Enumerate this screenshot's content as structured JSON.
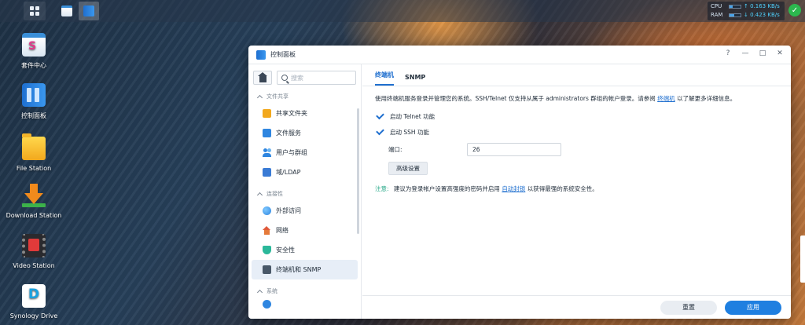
{
  "taskbar": {
    "resource_monitor": {
      "cpu_label": "CPU",
      "cpu_value": "↑ 0.163 KB/s",
      "ram_label": "RAM",
      "ram_value": "↓ 0.423 KB/s",
      "cpu_level": 0.3,
      "ram_level": 0.45
    },
    "status_color": "#2cb84e"
  },
  "desktop": {
    "icons": [
      {
        "label": "套件中心",
        "icon": "package-center-icon"
      },
      {
        "label": "控制面板",
        "icon": "control-panel-icon"
      },
      {
        "label": "File Station",
        "icon": "file-station-icon"
      },
      {
        "label": "Download Station",
        "icon": "download-station-icon"
      },
      {
        "label": "Video Station",
        "icon": "video-station-icon"
      },
      {
        "label": "Synology Drive",
        "icon": "synology-drive-icon"
      }
    ]
  },
  "window": {
    "title": "控制面板",
    "controls": {
      "help": "?",
      "minimize": "—",
      "maximize": "□",
      "close": "✕"
    },
    "sidebar": {
      "search_placeholder": "搜索",
      "sections": [
        {
          "title": "文件共享",
          "items": [
            "共享文件夹",
            "文件服务",
            "用户与群组",
            "域/LDAP"
          ]
        },
        {
          "title": "连接性",
          "items": [
            "外部访问",
            "网络",
            "安全性",
            "终端机和 SNMP"
          ]
        },
        {
          "title": "系统",
          "items": []
        }
      ],
      "active_item": "终端机和 SNMP"
    },
    "tabs": [
      "终端机",
      "SNMP"
    ],
    "active_tab": "终端机",
    "content": {
      "desc_prefix": "使用终端机服务登录并管理您的系统。SSH/Telnet 仅支持从属于 administrators 群组的帐户登录。请参阅",
      "desc_link": "终端机",
      "desc_suffix": "以了解更多详细信息。",
      "telnet_label": "启动 Telnet 功能",
      "ssh_label": "启动 SSH 功能",
      "port_label": "端口:",
      "port_value": "26",
      "advanced_button": "高级设置",
      "note_label": "注意:",
      "note_prefix": "建议为登录帐户设置高强度的密码并启用",
      "note_link": "自动封锁",
      "note_suffix": "以获得最强的系统安全性。"
    },
    "footer": {
      "reset": "重置",
      "apply": "应用"
    },
    "accent": "#1f7fe0"
  }
}
